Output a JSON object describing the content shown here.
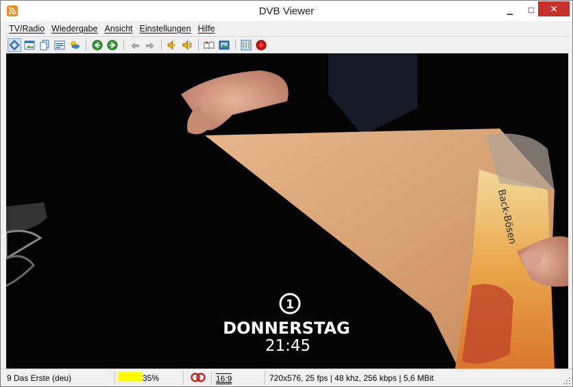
{
  "window": {
    "title": "DVB Viewer"
  },
  "titlebar": {
    "minimize_glyph": "▁",
    "maximize_glyph": "☐",
    "close_glyph": "✕"
  },
  "menu": {
    "items": [
      {
        "label": "TV/Radio"
      },
      {
        "label": "Wiedergabe"
      },
      {
        "label": "Ansicht"
      },
      {
        "label": "Einstellungen"
      },
      {
        "label": "Hilfe"
      }
    ]
  },
  "toolbar": {
    "icons": [
      "osd-icon",
      "window-mode-icon",
      "copy-icon",
      "teletext-icon",
      "epg-icon",
      "back-icon",
      "forward-icon",
      "zoom-out-icon",
      "zoom-in-icon",
      "volume-down-icon",
      "volume-up-icon",
      "book-icon",
      "picture-icon",
      "settings-icon",
      "record-icon"
    ],
    "colors": {
      "green": "#2e9a2e",
      "blue": "#2f6fc0",
      "record": "#d01010",
      "yellow": "#e8b400"
    }
  },
  "video": {
    "logo_text": "1",
    "day_text": "DONNERSTAG",
    "time_text": "21:45",
    "box_text": "Back-Bösen"
  },
  "statusbar": {
    "channel": "9 Das Erste (deu)",
    "signal_percent": "35%",
    "signal_level": 0.35,
    "signal_color": "#ffff00",
    "aspect": "16:9",
    "stream_info": "720x576, 25 fps | 48 khz, 256 kbps | 5,6 MBit"
  }
}
